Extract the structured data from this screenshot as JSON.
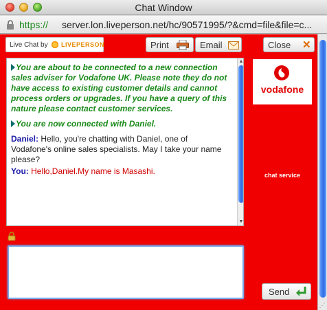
{
  "window": {
    "title": "Chat Window"
  },
  "urlbar": {
    "scheme": "https://",
    "rest": "server.lon.liveperson.net/hc/90571995/?&cmd=file&file=c..."
  },
  "toolbar": {
    "brand_label": "Live Chat by",
    "brand_name": "LIVEPERSON",
    "print_label": "Print",
    "email_label": "Email",
    "close_label": "Close",
    "close_glyph": "✕"
  },
  "transcript": {
    "system_messages": [
      "You are about to be connected to a new connection sales adviser for Vodafone UK. Please note they do not have access to existing customer details and cannot process orders or upgrades. If you have a query of this nature please contact customer services.",
      "You are now connected with Daniel."
    ],
    "agent_name": "Daniel:",
    "agent_message": "Hello, you're chatting with Daniel, one of Vodafone's online sales specialists.  May I take your name please?",
    "visitor_name": "You:",
    "visitor_message": "Hello,Daniel.My name is Masashi."
  },
  "side_panel": {
    "logo_text": "vodafone",
    "chat_service_label": "chat service"
  },
  "input": {
    "value": ""
  },
  "send_label": "Send",
  "colors": {
    "background_red": "#f00000",
    "system_green": "#1a8a1a",
    "agent_blue": "#1a1aa8",
    "visitor_red": "#d00000",
    "accent_orange": "#e58a00"
  },
  "icons": [
    "lock-icon",
    "printer-icon",
    "envelope-icon",
    "close-icon",
    "vodafone-logo-icon",
    "padlock-icon",
    "send-arrow-icon",
    "arrow-right-icon"
  ]
}
